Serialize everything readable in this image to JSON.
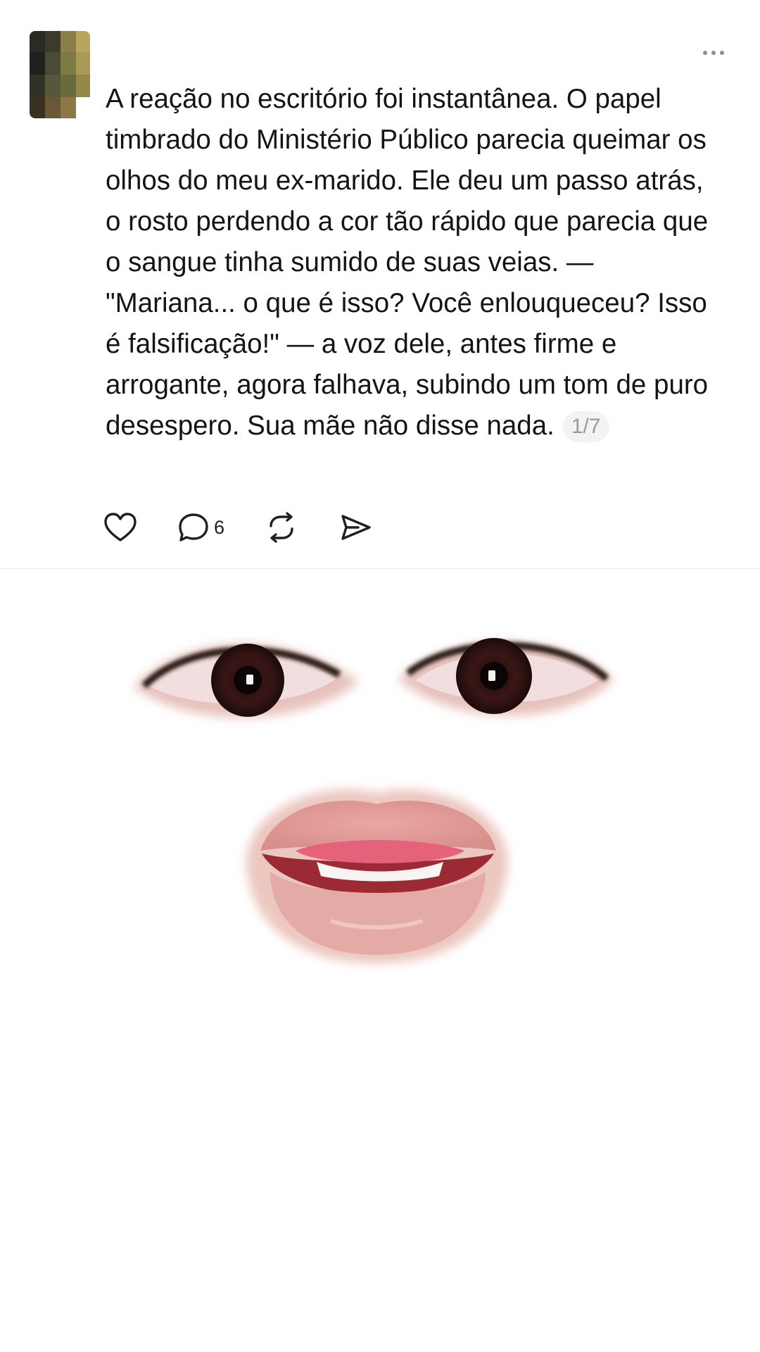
{
  "post": {
    "text": "A reação no escritório foi instantânea. O papel timbrado do Ministério Público parecia queimar os olhos do meu ex-marido. Ele deu um passo atrás, o rosto perdendo a cor tão rápido que parecia que o sangue tinha sumido de suas veias. — \"Mariana... o que é isso? Você enlouqueceu? Isso é falsificação!\" — a voz dele, antes firme e arrogante, agora falhava, subindo um tom de puro desespero. Sua mãe não disse nada.",
    "page_indicator": "1/7",
    "avatar_icon": "blurred-profile-avatar",
    "more_icon": "more-options-icon"
  },
  "actions": {
    "like_icon": "heart-icon",
    "comment_icon": "comment-bubble-icon",
    "comment_count": "6",
    "repost_icon": "repost-icon",
    "share_icon": "send-icon"
  },
  "image": {
    "content": "cut-out eyes and open mouth on white background"
  },
  "colors": {
    "background": "#ffffff",
    "text": "#141414",
    "muted": "#9a9a9a",
    "divider": "#ececec",
    "icon": "#1f1f1f"
  }
}
